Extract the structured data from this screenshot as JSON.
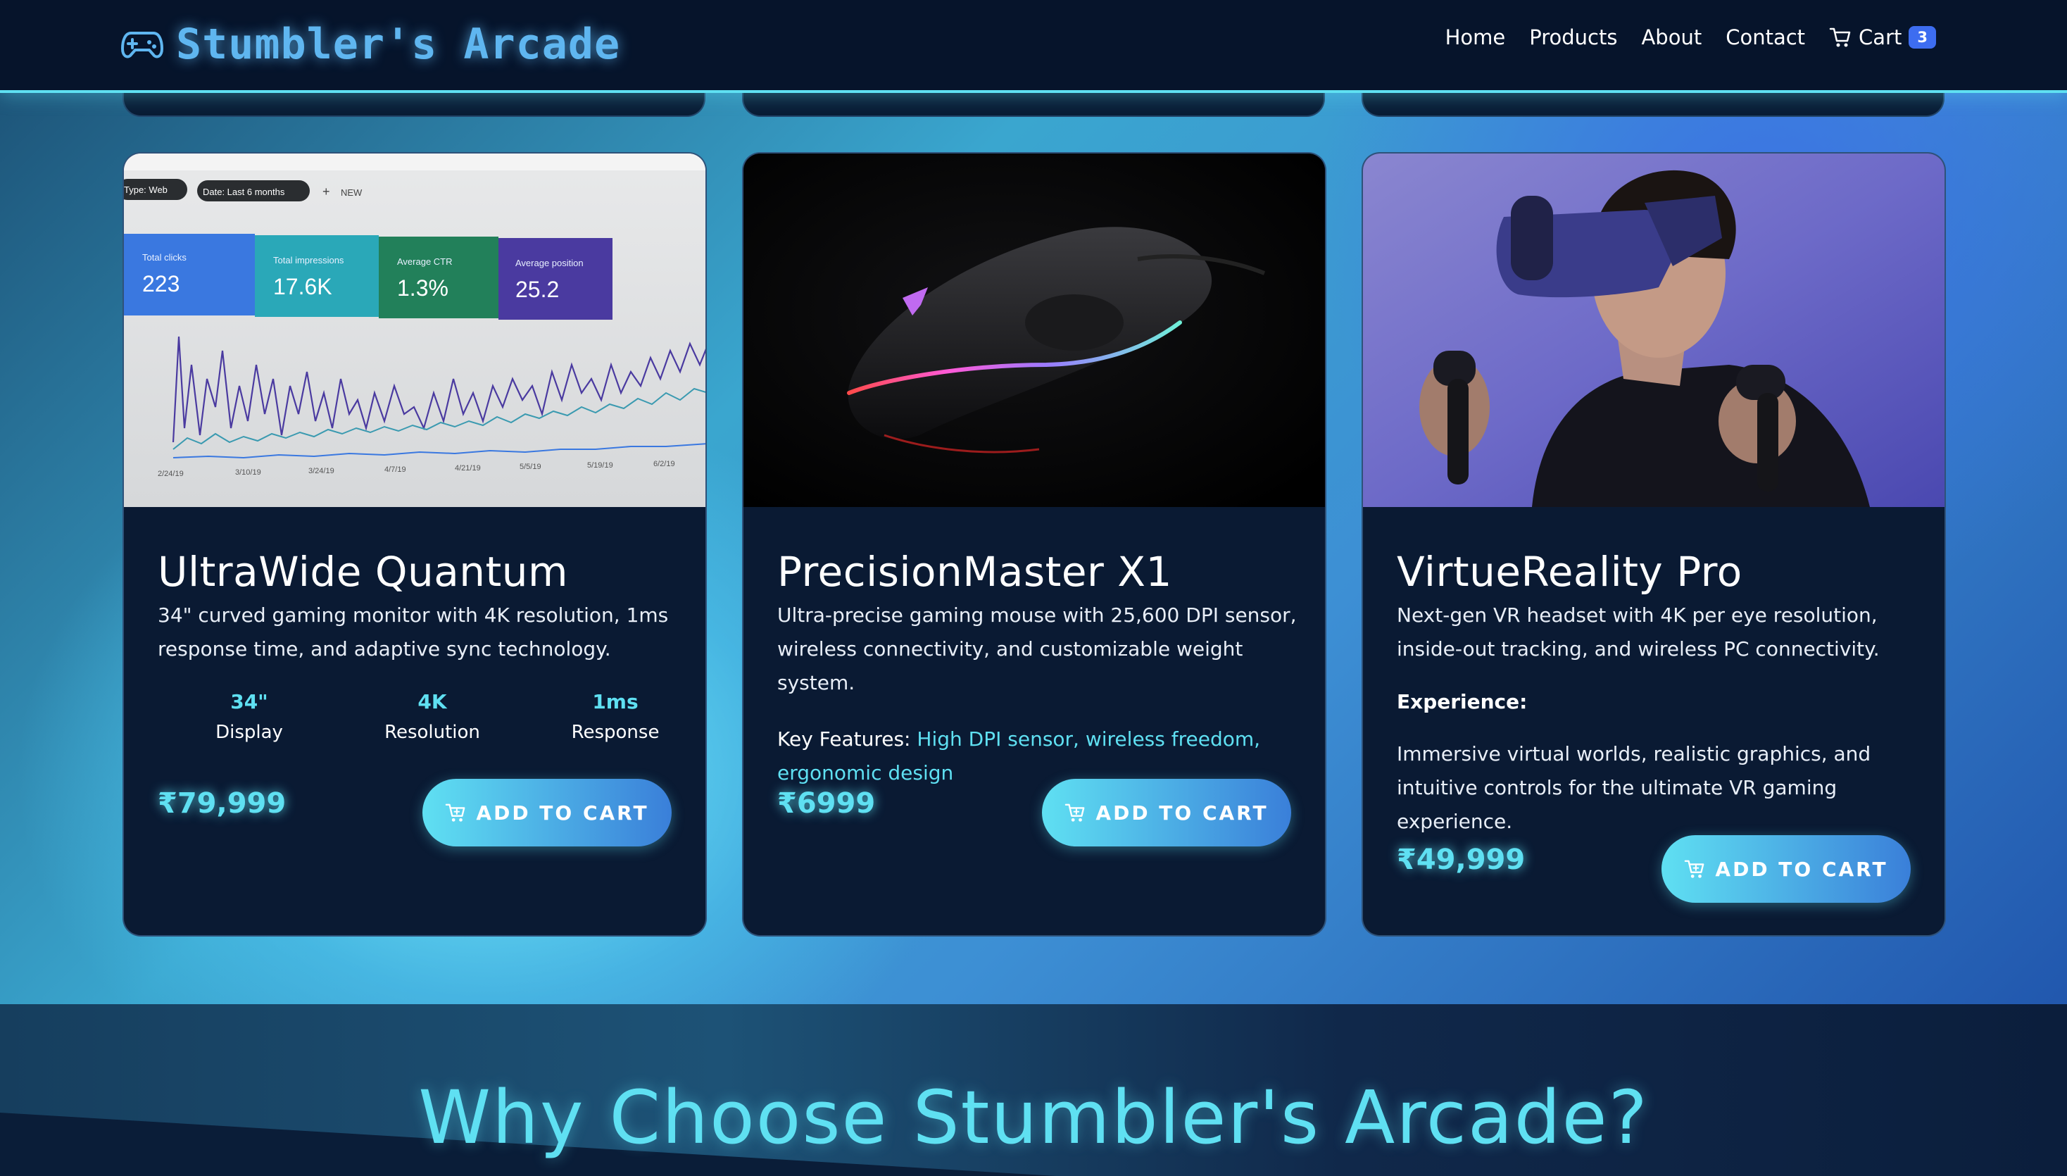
{
  "nav": {
    "brand": "Stumbler's Arcade",
    "links": [
      "Home",
      "Products",
      "About",
      "Contact"
    ],
    "cart_label": "Cart",
    "cart_count": "3"
  },
  "products": [
    {
      "title": "UltraWide Quantum",
      "description": "34\" curved gaming monitor with 4K resolution, 1ms response time, and adaptive sync technology.",
      "specs": [
        {
          "value": "34\"",
          "label": "Display"
        },
        {
          "value": "4K",
          "label": "Resolution"
        },
        {
          "value": "1ms",
          "label": "Response"
        }
      ],
      "price": "₹79,999",
      "button": "ADD TO CART",
      "image": {
        "chips": [
          "Type: Web",
          "Date: Last 6 months",
          "NEW"
        ],
        "metrics": [
          {
            "label": "Total clicks",
            "value": "223"
          },
          {
            "label": "Total impressions",
            "value": "17.6K"
          },
          {
            "label": "Average CTR",
            "value": "1.3%"
          },
          {
            "label": "Average position",
            "value": "25.2"
          }
        ],
        "dates": [
          "2/24/19",
          "3/10/19",
          "3/24/19",
          "4/7/19",
          "4/21/19",
          "5/5/19",
          "5/19/19",
          "6/2/19"
        ]
      }
    },
    {
      "title": "PrecisionMaster X1",
      "description": "Ultra-precise gaming mouse with 25,600 DPI sensor, wireless connectivity, and customizable weight system.",
      "features_label": "Key Features:",
      "features": "High DPI sensor, wireless freedom, ergonomic design",
      "price": "₹6999",
      "button": "ADD TO CART"
    },
    {
      "title": "VirtueReality Pro",
      "description": "Next-gen VR headset with 4K per eye resolution, inside-out tracking, and wireless PC connectivity.",
      "experience_label": "Experience:",
      "experience": "Immersive virtual worlds, realistic graphics, and intuitive controls for the ultimate VR gaming experience.",
      "price": "₹49,999",
      "button": "ADD TO CART"
    }
  ],
  "why": {
    "title": "Why Choose Stumbler's Arcade?",
    "subtitle": "..."
  },
  "colors": {
    "accent": "#5fe0f2",
    "nav_bg": "#06142b",
    "card_bg": "#0a1a33",
    "badge": "#3d6df0"
  }
}
